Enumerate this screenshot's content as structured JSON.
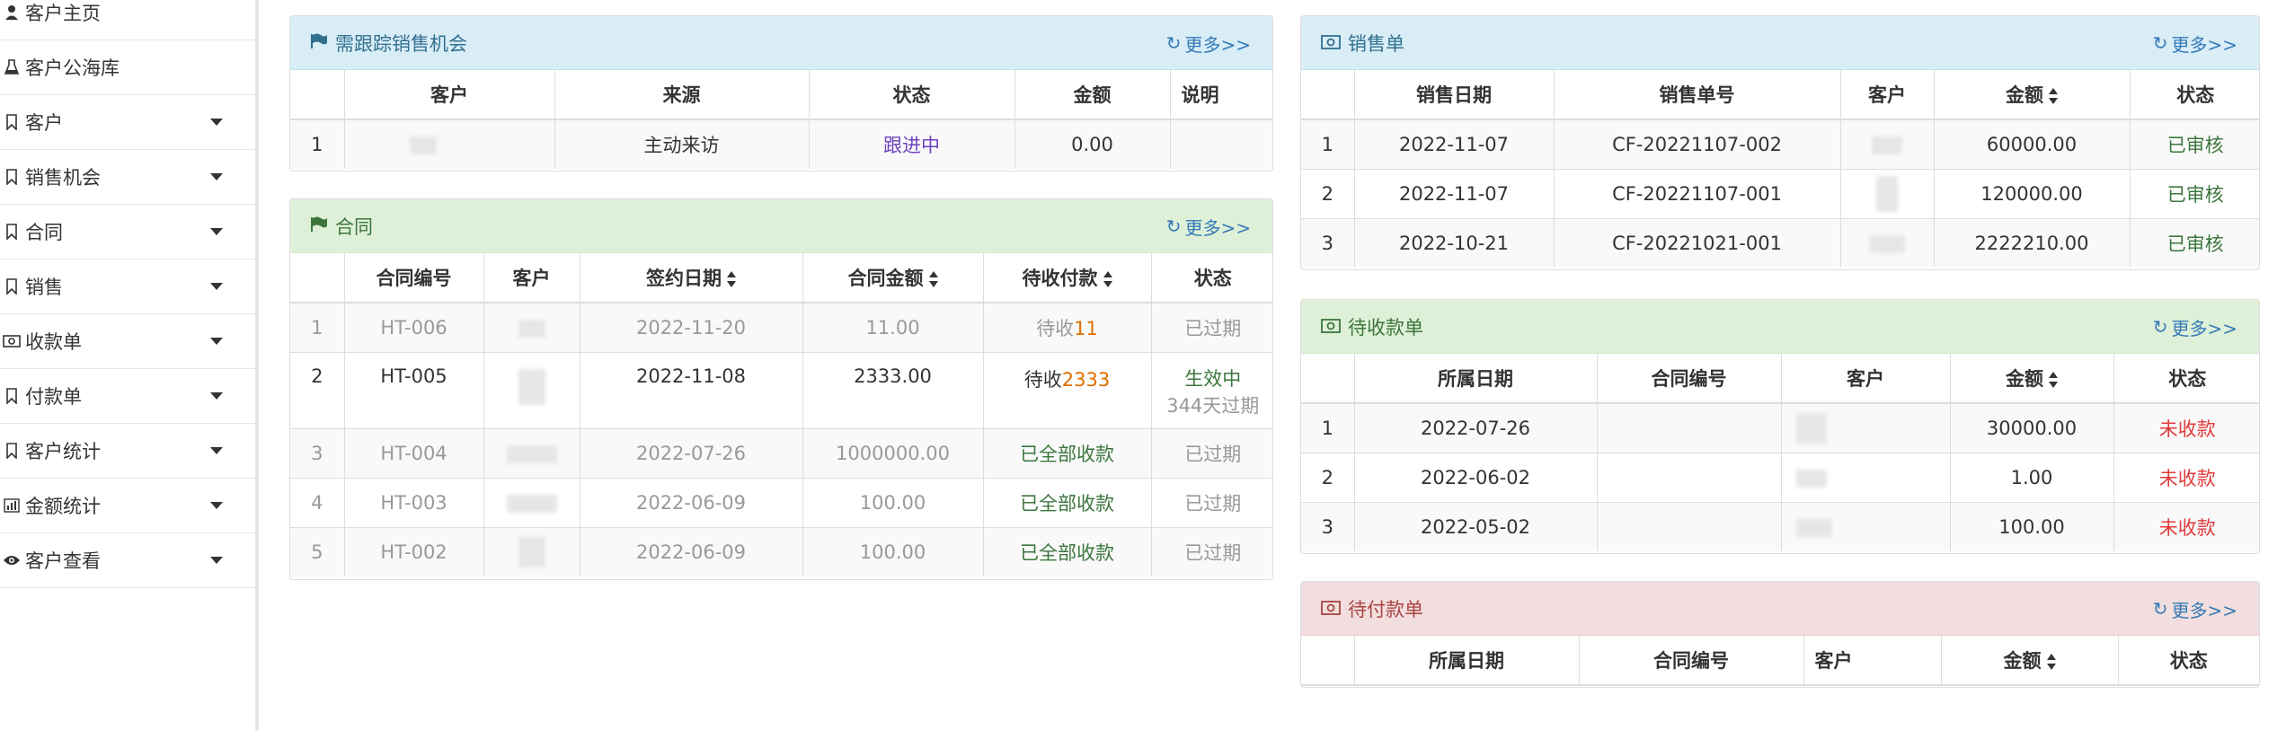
{
  "sidebar": {
    "items": [
      {
        "label": "客户主页",
        "icon": "person-icon",
        "caret": false
      },
      {
        "label": "客户公海库",
        "icon": "flask-icon",
        "caret": false
      },
      {
        "label": "客户",
        "icon": "bookmark-icon",
        "caret": true
      },
      {
        "label": "销售机会",
        "icon": "bookmark-icon",
        "caret": true
      },
      {
        "label": "合同",
        "icon": "bookmark-icon",
        "caret": true
      },
      {
        "label": "销售",
        "icon": "bookmark-icon",
        "caret": true
      },
      {
        "label": "收款单",
        "icon": "money-icon",
        "caret": true
      },
      {
        "label": "付款单",
        "icon": "bookmark-icon",
        "caret": true
      },
      {
        "label": "客户统计",
        "icon": "bookmark-icon",
        "caret": true
      },
      {
        "label": "金额统计",
        "icon": "bar-chart-icon",
        "caret": true
      },
      {
        "label": "客户查看",
        "icon": "eye-icon",
        "caret": true
      }
    ]
  },
  "more_label": "更多>>",
  "opportunities": {
    "title": "需跟踪销售机会",
    "headers": [
      "",
      "客户",
      "来源",
      "状态",
      "金额",
      "说明"
    ],
    "rows": [
      {
        "no": "1",
        "customer": "",
        "source": "主动来访",
        "status": "跟进中",
        "amount": "0.00",
        "note": ""
      }
    ]
  },
  "contracts": {
    "title": "合同",
    "headers": [
      "",
      "合同编号",
      "客户",
      "签约日期",
      "合同金额",
      "待收付款",
      "状态"
    ],
    "rows": [
      {
        "no": "1",
        "code": "HT-006",
        "date": "2022-11-20",
        "amount": "11.00",
        "pending_prefix": "待收",
        "pending_value": "11",
        "status": "已过期",
        "status_sub": ""
      },
      {
        "no": "2",
        "code": "HT-005",
        "date": "2022-11-08",
        "amount": "2333.00",
        "pending_prefix": "待收",
        "pending_value": "2333",
        "status": "生效中",
        "status_sub": "344天过期"
      },
      {
        "no": "3",
        "code": "HT-004",
        "date": "2022-07-26",
        "amount": "1000000.00",
        "pending_prefix": "",
        "pending_value": "已全部收款",
        "status": "已过期",
        "status_sub": ""
      },
      {
        "no": "4",
        "code": "HT-003",
        "date": "2022-06-09",
        "amount": "100.00",
        "pending_prefix": "",
        "pending_value": "已全部收款",
        "status": "已过期",
        "status_sub": ""
      },
      {
        "no": "5",
        "code": "HT-002",
        "date": "2022-06-09",
        "amount": "100.00",
        "pending_prefix": "",
        "pending_value": "已全部收款",
        "status": "已过期",
        "status_sub": ""
      }
    ]
  },
  "sales": {
    "title": "销售单",
    "headers": [
      "",
      "销售日期",
      "销售单号",
      "客户",
      "金额",
      "状态"
    ],
    "rows": [
      {
        "no": "1",
        "date": "2022-11-07",
        "code": "CF-20221107-002",
        "amount": "60000.00",
        "status": "已审核"
      },
      {
        "no": "2",
        "date": "2022-11-07",
        "code": "CF-20221107-001",
        "amount": "120000.00",
        "status": "已审核"
      },
      {
        "no": "3",
        "date": "2022-10-21",
        "code": "CF-20221021-001",
        "amount": "2222210.00",
        "status": "已审核"
      }
    ]
  },
  "receivables": {
    "title": "待收款单",
    "headers": [
      "",
      "所属日期",
      "合同编号",
      "客户",
      "金额",
      "状态"
    ],
    "rows": [
      {
        "no": "1",
        "date": "2022-07-26",
        "code": "",
        "amount": "30000.00",
        "status": "未收款"
      },
      {
        "no": "2",
        "date": "2022-06-02",
        "code": "",
        "amount": "1.00",
        "status": "未收款"
      },
      {
        "no": "3",
        "date": "2022-05-02",
        "code": "",
        "amount": "100.00",
        "status": "未收款"
      }
    ]
  },
  "payables": {
    "title": "待付款单",
    "headers": [
      "",
      "所属日期",
      "合同编号",
      "客户",
      "金额",
      "状态"
    ]
  },
  "colors": {
    "info_bg": "#d9edf7",
    "success_bg": "#dff0d8",
    "danger_bg": "#f2dede",
    "link": "#337ab7",
    "status_green": "#3c763d",
    "status_red": "#e03a3a",
    "status_purple": "#6f42c1",
    "pending_orange": "#e06c00"
  }
}
